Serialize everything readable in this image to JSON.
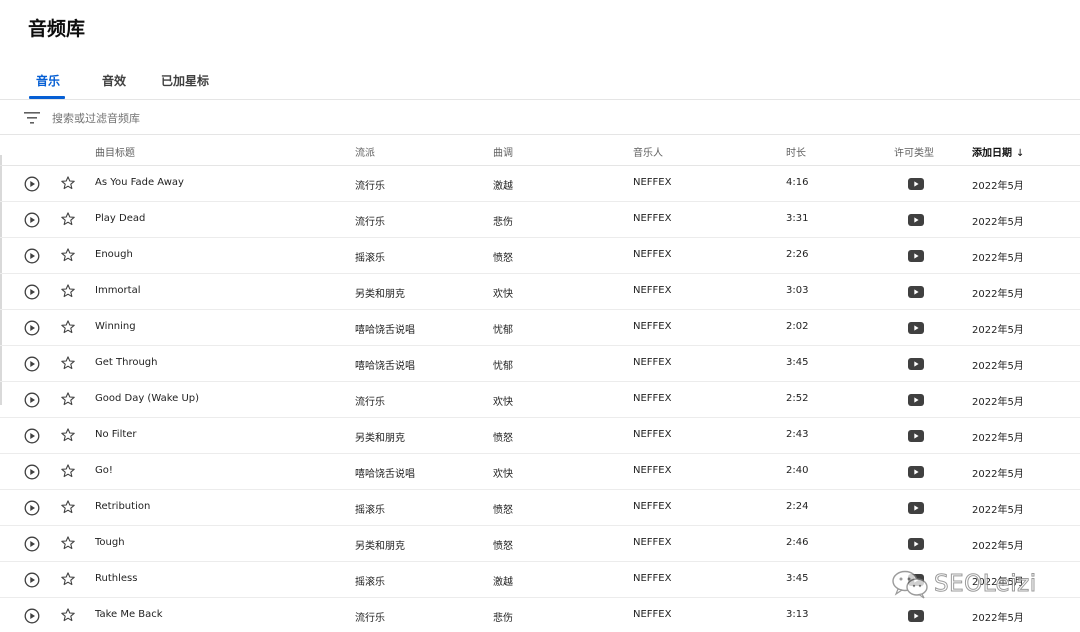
{
  "page": {
    "title": "音频库"
  },
  "tabs": [
    {
      "label": "音乐",
      "active": true
    },
    {
      "label": "音效",
      "active": false
    },
    {
      "label": "已加星标",
      "active": false
    }
  ],
  "filter": {
    "placeholder": "搜索或过滤音频库",
    "icon": "filter-icon"
  },
  "table": {
    "headers": {
      "title": "曲目标题",
      "genre": "流派",
      "mood": "曲调",
      "artist": "音乐人",
      "duration": "时长",
      "license": "许可类型",
      "date_added": "添加日期",
      "sort_arrow": "↓"
    },
    "rows": [
      {
        "title": "As You Fade Away",
        "genre": "流行乐",
        "mood": "激越",
        "artist": "NEFFEX",
        "duration": "4:16",
        "date": "2022年5月"
      },
      {
        "title": "Play Dead",
        "genre": "流行乐",
        "mood": "悲伤",
        "artist": "NEFFEX",
        "duration": "3:31",
        "date": "2022年5月"
      },
      {
        "title": "Enough",
        "genre": "摇滚乐",
        "mood": "愤怒",
        "artist": "NEFFEX",
        "duration": "2:26",
        "date": "2022年5月"
      },
      {
        "title": "Immortal",
        "genre": "另类和朋克",
        "mood": "欢快",
        "artist": "NEFFEX",
        "duration": "3:03",
        "date": "2022年5月"
      },
      {
        "title": "Winning",
        "genre": "嘻哈饶舌说唱",
        "mood": "忧郁",
        "artist": "NEFFEX",
        "duration": "2:02",
        "date": "2022年5月"
      },
      {
        "title": "Get Through",
        "genre": "嘻哈饶舌说唱",
        "mood": "忧郁",
        "artist": "NEFFEX",
        "duration": "3:45",
        "date": "2022年5月"
      },
      {
        "title": "Good Day (Wake Up)",
        "genre": "流行乐",
        "mood": "欢快",
        "artist": "NEFFEX",
        "duration": "2:52",
        "date": "2022年5月"
      },
      {
        "title": "No Filter",
        "genre": "另类和朋克",
        "mood": "愤怒",
        "artist": "NEFFEX",
        "duration": "2:43",
        "date": "2022年5月"
      },
      {
        "title": "Go!",
        "genre": "嘻哈饶舌说唱",
        "mood": "欢快",
        "artist": "NEFFEX",
        "duration": "2:40",
        "date": "2022年5月"
      },
      {
        "title": "Retribution",
        "genre": "摇滚乐",
        "mood": "愤怒",
        "artist": "NEFFEX",
        "duration": "2:24",
        "date": "2022年5月"
      },
      {
        "title": "Tough",
        "genre": "另类和朋克",
        "mood": "愤怒",
        "artist": "NEFFEX",
        "duration": "2:46",
        "date": "2022年5月"
      },
      {
        "title": "Ruthless",
        "genre": "摇滚乐",
        "mood": "激越",
        "artist": "NEFFEX",
        "duration": "3:45",
        "date": "2022年5月"
      },
      {
        "title": "Take Me Back",
        "genre": "流行乐",
        "mood": "悲伤",
        "artist": "NEFFEX",
        "duration": "3:13",
        "date": "2022年5月"
      }
    ]
  },
  "watermark": {
    "text": "SEOLeizi",
    "icon": "wechat-icon"
  },
  "colors": {
    "accent": "#065fd4",
    "text": "#0d0d0d",
    "muted": "#606060",
    "divider": "#e5e5e5"
  }
}
